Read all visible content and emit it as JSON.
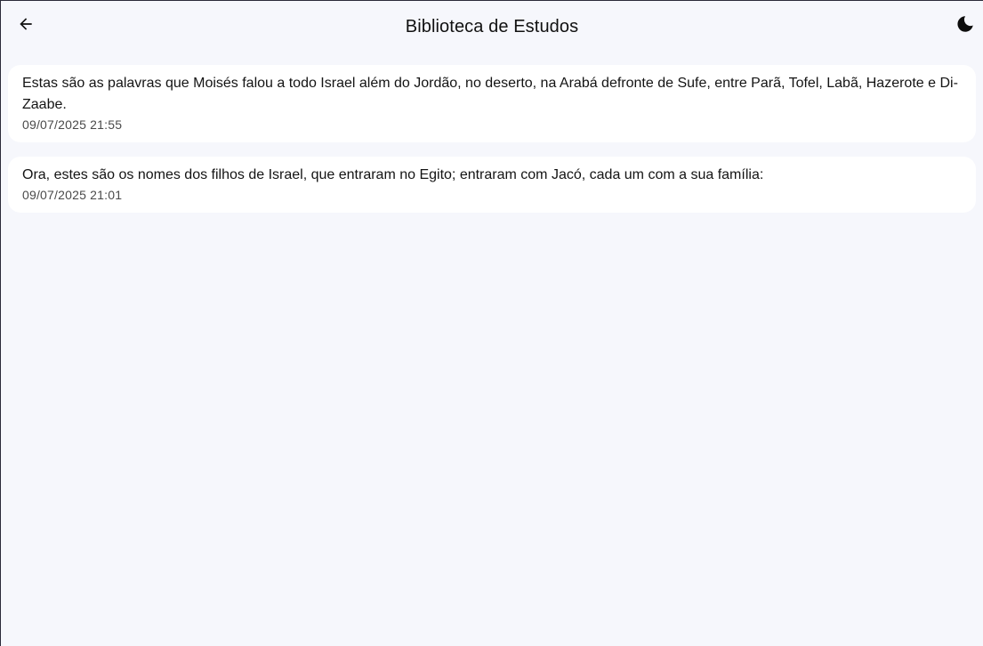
{
  "header": {
    "title": "Biblioteca de Estudos",
    "back_icon": "arrow-left-icon",
    "theme_icon": "moon-icon"
  },
  "studies": [
    {
      "text": "Estas são as palavras que Moisés falou a todo Israel além do Jordão, no deserto, na Arabá defronte de Sufe, entre Parã, Tofel, Labã, Hazerote e Di-Zaabe.",
      "date": "09/07/2025 21:55"
    },
    {
      "text": "Ora, estes são os nomes dos filhos de Israel, que entraram no Egito; entraram com Jacó, cada um com a sua família:",
      "date": "09/07/2025 21:01"
    }
  ],
  "colors": {
    "background": "#f6f7fc",
    "card": "#ffffff",
    "text": "#141414",
    "secondary_text": "#4a4a4a"
  }
}
